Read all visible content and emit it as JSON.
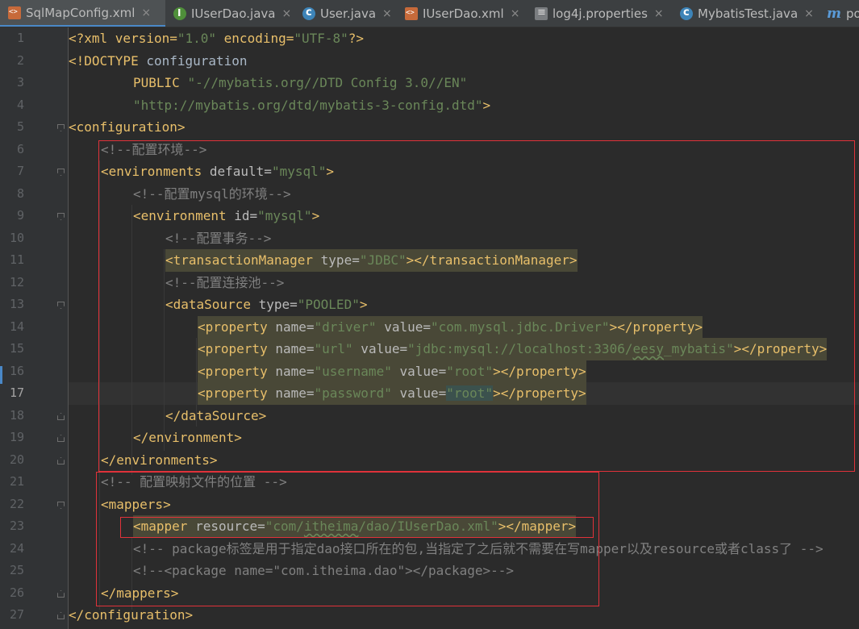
{
  "tabs": [
    {
      "label": "SqlMapConfig.xml",
      "icon": "xml-file-icon",
      "active": true
    },
    {
      "label": "IUserDao.java",
      "icon": "interface-icon",
      "active": false
    },
    {
      "label": "User.java",
      "icon": "class-icon",
      "active": false
    },
    {
      "label": "IUserDao.xml",
      "icon": "xml-file-icon",
      "active": false
    },
    {
      "label": "log4j.properties",
      "icon": "properties-file-icon",
      "active": false
    },
    {
      "label": "MybatisTest.java",
      "icon": "class-icon",
      "active": false
    },
    {
      "label": "po",
      "icon": "maven-icon",
      "active": false
    }
  ],
  "tab_close_glyph": "×",
  "current_line": 17,
  "line_numbers": [
    "1",
    "2",
    "3",
    "4",
    "5",
    "6",
    "7",
    "8",
    "9",
    "10",
    "11",
    "12",
    "13",
    "14",
    "15",
    "16",
    "17",
    "18",
    "19",
    "20",
    "21",
    "22",
    "23",
    "24",
    "25",
    "26",
    "27"
  ],
  "code": {
    "l1": {
      "a": "<?xml version=",
      "b": "\"1.0\"",
      "c": " encoding=",
      "d": "\"UTF-8\"",
      "e": "?>"
    },
    "l2": {
      "a": "<!DOCTYPE ",
      "b": "configuration"
    },
    "l3": {
      "a": "PUBLIC ",
      "b": "\"-//mybatis.org//DTD Config 3.0//EN\""
    },
    "l4": {
      "b": "\"http://mybatis.org/dtd/mybatis-3-config.dtd\"",
      "e": ">"
    },
    "l5": {
      "a": "<configuration>"
    },
    "l6": {
      "c": "<!--配置环境-->"
    },
    "l7": {
      "t": "<environments",
      "n": " default=",
      "v": "\"mysql\"",
      "e": ">"
    },
    "l8": {
      "c": "<!--配置mysql的环境-->"
    },
    "l9": {
      "t": "<environment",
      "n": " id=",
      "v": "\"mysql\"",
      "e": ">"
    },
    "l10": {
      "c": "<!--配置事务-->"
    },
    "l11": {
      "t": "<transactionManager",
      "n": " type=",
      "v": "\"JDBC\"",
      "e": "></transactionManager>"
    },
    "l12": {
      "c": "<!--配置连接池-->"
    },
    "l13": {
      "t": "<dataSource",
      "n": " type=",
      "v": "\"POOLED\"",
      "e": ">"
    },
    "l14": {
      "t": "<property",
      "n1": " name=",
      "v1": "\"driver\"",
      "n2": " value=",
      "v2": "\"com.mysql.jdbc.Driver\"",
      "e": "></property>"
    },
    "l15": {
      "t": "<property",
      "n1": " name=",
      "v1": "\"url\"",
      "n2": " value=",
      "v2a": "\"jdbc:mysql://localhost:3306/",
      "v2b": "eesy",
      "v2c": "_mybatis\"",
      "e": "></property>"
    },
    "l16": {
      "t": "<property",
      "n1": " name=",
      "v1": "\"username\"",
      "n2": " value=",
      "v2": "\"root\"",
      "e": "></property>"
    },
    "l17": {
      "t": "<property",
      "n1": " name=",
      "v1": "\"password\"",
      "n2": " value=",
      "v2": "\"root\"",
      "e": "></property>"
    },
    "l18": {
      "t": "</dataSource>"
    },
    "l19": {
      "t": "</environment>"
    },
    "l20": {
      "t": "</environments>"
    },
    "l21": {
      "c": "<!-- 配置映射文件的位置 -->"
    },
    "l22": {
      "t": "<mappers>"
    },
    "l23": {
      "t": "<mapper",
      "n": " resource=",
      "va": "\"com/",
      "vb": "itheima",
      "vc": "/dao/IUserDao.xml\"",
      "e": "></mapper>"
    },
    "l24": {
      "c": "<!-- package标签是用于指定dao接口所在的包,当指定了之后就不需要在写mapper以及resource或者class了 -->"
    },
    "l25": {
      "c": "<!--<package name=\"com.itheima.dao\"></package>-->"
    },
    "l26": {
      "t": "</mappers>"
    },
    "l27": {
      "t": "</configuration>"
    }
  }
}
